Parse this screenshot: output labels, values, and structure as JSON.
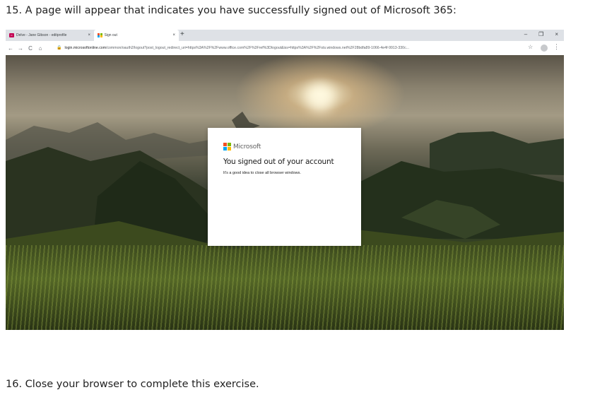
{
  "instructions": {
    "step15": "15. A page will appear that indicates you have successfully signed out of Microsoft 365:",
    "step16": "16. Close your browser to complete this exercise."
  },
  "browser": {
    "tabs": [
      {
        "label": "Delve - Jane Gibson - editprofile",
        "icon": "delve-icon",
        "active": false
      },
      {
        "label": "Sign out",
        "icon": "microsoft-logo-icon",
        "active": true
      }
    ],
    "new_tab_label": "+",
    "window_controls": {
      "minimize": "–",
      "restore": "❐",
      "close": "×"
    },
    "address_host": "login.microsoftonline.com",
    "address_path": "/common/oauth2/logout?post_logout_redirect_uri=https%3A%2F%2Fwww.office.com%2F%3Fref%3Dlogout&iss=https%3A%2F%2Fsts.windows.net%2F28bdfa89-1066-4e4f-9913-330c...",
    "nav": {
      "back": "←",
      "forward": "→",
      "reload": "C",
      "home": "⌂"
    }
  },
  "dialog": {
    "brand": "Microsoft",
    "title": "You signed out of your account",
    "message": "It's a good idea to close all browser windows."
  },
  "colors": {
    "ms_red": "#f25022",
    "ms_green": "#7fba00",
    "ms_blue": "#00a4ef",
    "ms_yellow": "#ffb900",
    "delve_pink": "#c30052"
  }
}
